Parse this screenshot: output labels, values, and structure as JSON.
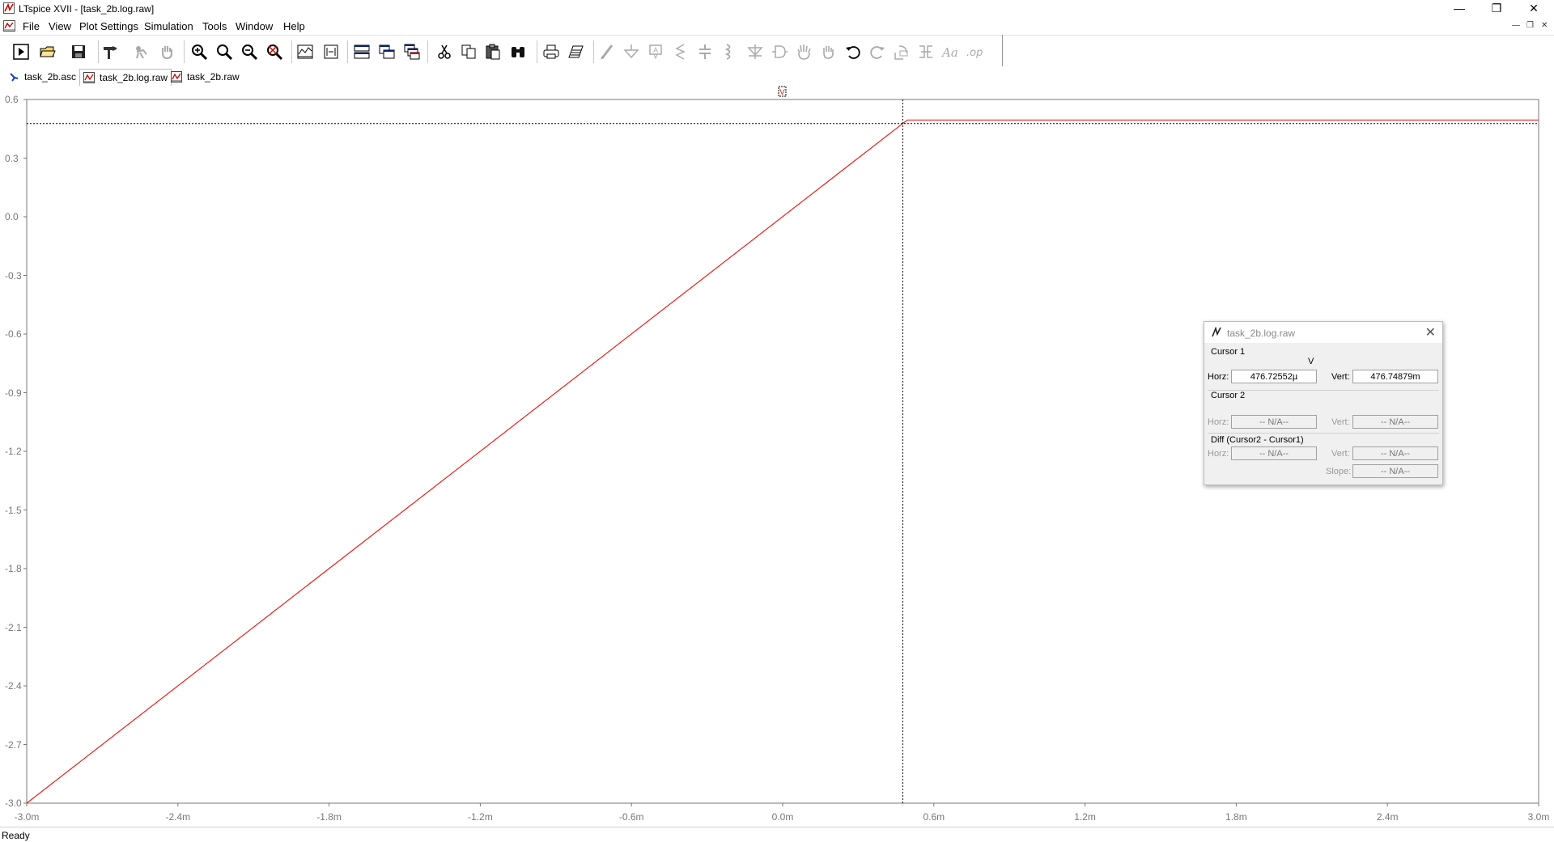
{
  "window": {
    "title": "LTspice XVII - [task_2b.log.raw]",
    "minimize_glyph": "—",
    "restore_glyph": "❐",
    "close_glyph": "✕"
  },
  "menu": {
    "items": [
      "File",
      "View",
      "Plot Settings",
      "Simulation",
      "Tools",
      "Window",
      "Help"
    ],
    "mdi_minimize": "—",
    "mdi_restore": "❐",
    "mdi_close": "✕"
  },
  "toolbar": {
    "buttons": [
      {
        "name": "run-simulation-icon"
      },
      {
        "name": "open-file-icon"
      },
      {
        "name": "save-file-icon"
      },
      {
        "name": "control-panel-hammer-icon"
      },
      {
        "name": "halt-simulation-icon"
      },
      {
        "name": "pan-hand-icon"
      },
      {
        "name": "zoom-in-icon"
      },
      {
        "name": "zoom-area-icon"
      },
      {
        "name": "zoom-out-icon"
      },
      {
        "name": "zoom-fit-icon"
      },
      {
        "name": "autorange-plot-icon"
      },
      {
        "name": "fit-to-window-icon"
      },
      {
        "name": "tile-horizontal-icon"
      },
      {
        "name": "tile-vertical-icon"
      },
      {
        "name": "cascade-windows-icon"
      },
      {
        "name": "cut-icon"
      },
      {
        "name": "copy-icon"
      },
      {
        "name": "paste-icon"
      },
      {
        "name": "find-binoculars-icon"
      },
      {
        "name": "print-icon"
      },
      {
        "name": "print-setup-icon"
      },
      {
        "name": "draw-wire-icon"
      },
      {
        "name": "ground-icon"
      },
      {
        "name": "label-net-icon"
      },
      {
        "name": "resistor-icon"
      },
      {
        "name": "capacitor-icon"
      },
      {
        "name": "inductor-icon"
      },
      {
        "name": "diode-icon"
      },
      {
        "name": "component-icon"
      },
      {
        "name": "move-hand-icon"
      },
      {
        "name": "drag-hand-icon"
      },
      {
        "name": "undo-icon"
      },
      {
        "name": "redo-icon"
      },
      {
        "name": "rotate-icon"
      },
      {
        "name": "mirror-icon"
      },
      {
        "name": "text-icon"
      },
      {
        "name": "spice-directive-icon"
      }
    ]
  },
  "tabs": [
    {
      "label": "task_2b.asc",
      "icon": "schematic-icon",
      "active": false
    },
    {
      "label": "task_2b.log.raw",
      "icon": "waveform-icon",
      "active": true
    },
    {
      "label": "task_2b.raw",
      "icon": "waveform-icon",
      "active": false
    }
  ],
  "plot": {
    "trace_label": "V",
    "trace_color": "#e8201c",
    "cursor_color": "#000000",
    "y_ticks": [
      "0.6",
      "0.3",
      "0.0",
      "-0.3",
      "-0.6",
      "-0.9",
      "-1.2",
      "-1.5",
      "-1.8",
      "-2.1",
      "-2.4",
      "-2.7",
      "-3.0"
    ],
    "x_ticks": [
      "-3.0m",
      "-2.4m",
      "-1.8m",
      "-1.2m",
      "-0.6m",
      "0.0m",
      "0.6m",
      "1.2m",
      "1.8m",
      "2.4m",
      "3.0m"
    ]
  },
  "chart_data": {
    "type": "line",
    "title": "",
    "xlabel": "",
    "ylabel": "",
    "xlim": [
      -0.003,
      0.003
    ],
    "ylim": [
      -3.0,
      0.6
    ],
    "series": [
      {
        "name": "V",
        "color": "#e8201c",
        "x": [
          -0.003,
          0.000476,
          0.000495,
          0.003
        ],
        "y": [
          -3.0,
          0.4767,
          0.4948,
          0.4948
        ]
      }
    ],
    "cursor": {
      "x": 0.00047672552,
      "y": 0.47674879
    }
  },
  "cursor_dialog": {
    "title": "task_2b.log.raw",
    "close_glyph": "✕",
    "cursor1_label": "Cursor 1",
    "trace_name": "V",
    "horz_label": "Horz:",
    "vert_label": "Vert:",
    "cursor1_horz": "476.72552µ",
    "cursor1_vert": "476.74879m",
    "cursor2_label": "Cursor 2",
    "cursor2_horz": "-- N/A--",
    "cursor2_vert": "-- N/A--",
    "diff_label": "Diff (Cursor2 - Cursor1)",
    "diff_horz": "-- N/A--",
    "diff_vert": "-- N/A--",
    "slope_label": "Slope:",
    "slope_value": "-- N/A--"
  },
  "status": {
    "text": "Ready"
  }
}
